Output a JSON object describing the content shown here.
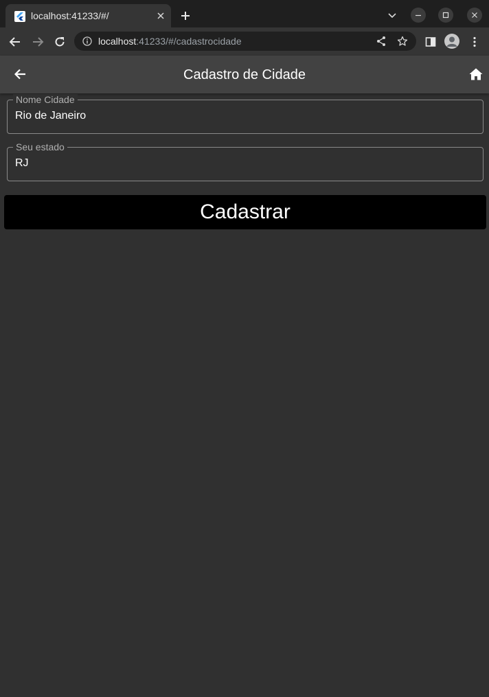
{
  "browser": {
    "tab_title": "localhost:41233/#/",
    "url_host": "localhost",
    "url_path": ":41233/#/cadastrocidade"
  },
  "appbar": {
    "title": "Cadastro de Cidade"
  },
  "form": {
    "city_label": "Nome Cidade",
    "city_value": "Rio de Janeiro",
    "state_label": "Seu estado",
    "state_value": "RJ",
    "submit_label": "Cadastrar"
  },
  "icons": {
    "favicon": "flutter-icon",
    "back": "arrow-left-icon",
    "home": "home-icon"
  },
  "colors": {
    "background": "#303030",
    "appbar": "#424242",
    "button": "#000000"
  }
}
